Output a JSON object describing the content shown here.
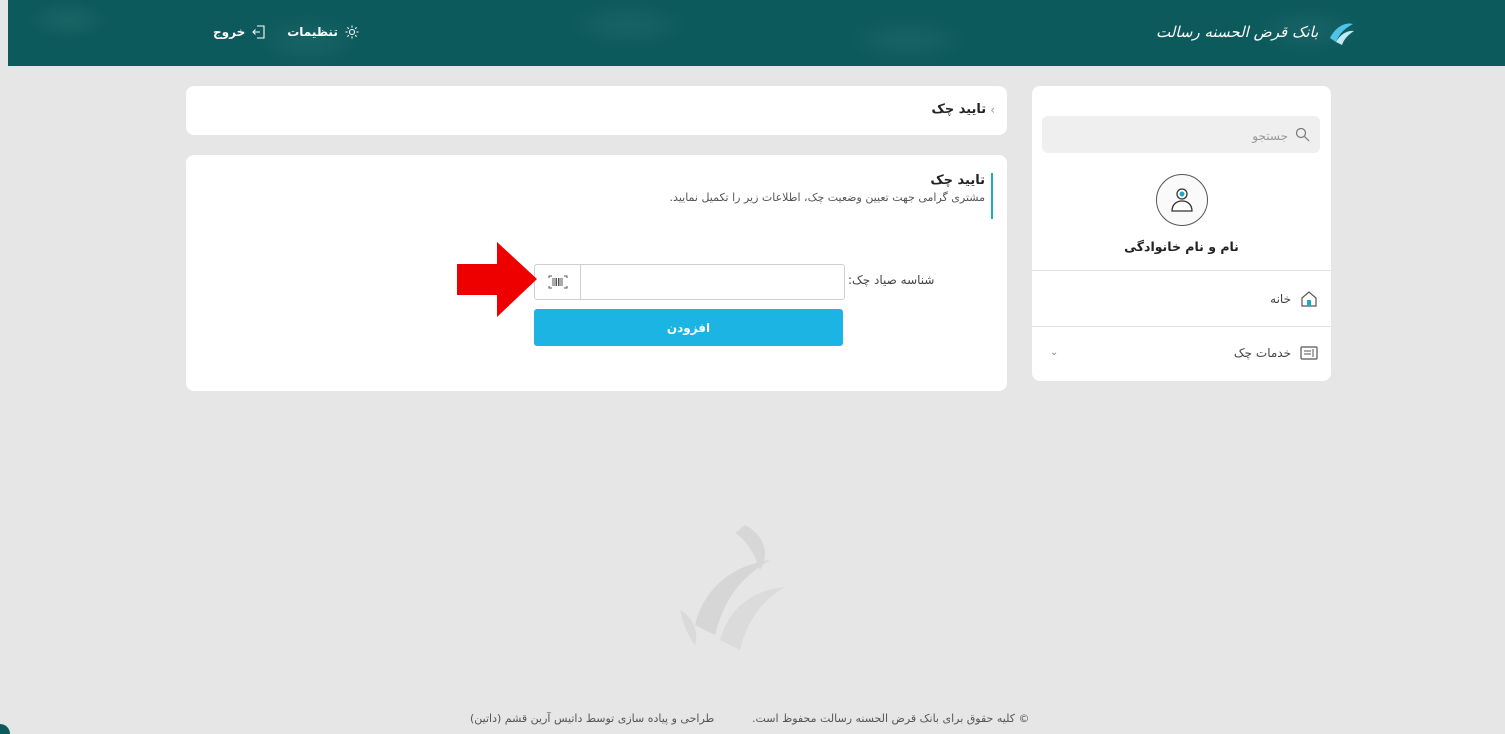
{
  "header": {
    "brand_name": "بانک قرض الحسنه رسالت",
    "logo_icon": "resalat-logo-icon",
    "settings_label": "تنظیمات",
    "logout_label": "خروج",
    "background_color": "#0c5a5c"
  },
  "breadcrumb": {
    "current": "تایید چک"
  },
  "form": {
    "title": "تایید چک",
    "subtitle": "مشتری گرامی جهت تعیین وضعیت چک، اطلاعات زیر را تکمیل نمایید.",
    "field_label": "شناسه صیاد چک:",
    "field_value": "",
    "scan_icon": "barcode-scan-icon",
    "submit_label": "افزودن",
    "accent_color": "#1cb4e3"
  },
  "sidebar": {
    "search_placeholder": "جستجو",
    "user_name": "نام و نام خانوادگی",
    "menu": [
      {
        "label": "خانه",
        "icon": "home-icon"
      },
      {
        "label": "خدمات چک",
        "icon": "list-icon"
      }
    ]
  },
  "footer": {
    "copyright": "© کلیه حقوق برای بانک قرض الحسنه رسالت محفوظ است.",
    "credit": "طراحی و پیاده سازی توسط داتیس آرین قشم (داتین)"
  }
}
